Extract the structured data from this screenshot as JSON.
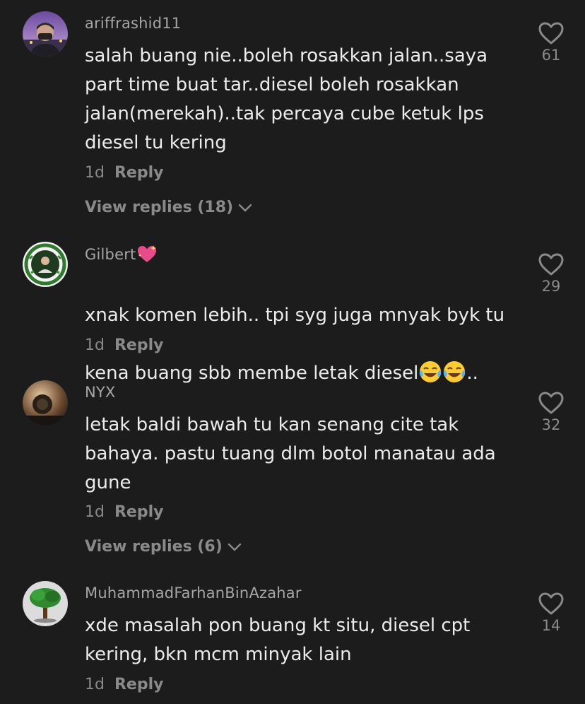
{
  "comments": [
    {
      "username": "ariffrashid11",
      "text": "salah buang nie..boleh rosakkan jalan..saya\npart time buat tar..diesel boleh rosakkan\njalan(merekah)..tak percaya cube ketuk lps\ndiesel tu kering",
      "time": "1d",
      "reply_label": "Reply",
      "view_replies": "View replies (18)",
      "likes": "61"
    },
    {
      "username": "Gilbert",
      "username_emoji": "sparkling-heart",
      "text_line1": "xnak komen lebih.. tpi syg juga mnyak byk tu",
      "text_line2": "kena buang sbb membe letak diesel",
      "text_suffix": "..",
      "time": "1d",
      "reply_label": "Reply",
      "likes": "29"
    },
    {
      "username": "NYX",
      "text": "letak baldi bawah tu kan senang cite tak\nbahaya. pastu tuang dlm botol manatau ada\ngune",
      "time": "1d",
      "reply_label": "Reply",
      "view_replies": "View replies (6)",
      "likes": "32"
    },
    {
      "username": "MuhammadFarhanBinAzahar",
      "text": "xde masalah pon buang kt situ, diesel cpt\nkering, bkn mcm minyak lain",
      "time": "1d",
      "reply_label": "Reply",
      "likes": "14"
    }
  ],
  "colors": {
    "background": "#1c1c1c",
    "username": "#a6a6a6",
    "text": "#ececec",
    "meta": "#8a8a8a"
  },
  "icons": [
    "heart-outline-icon",
    "chevron-down-icon",
    "sparkling-heart-emoji",
    "tears-of-joy-emoji"
  ]
}
